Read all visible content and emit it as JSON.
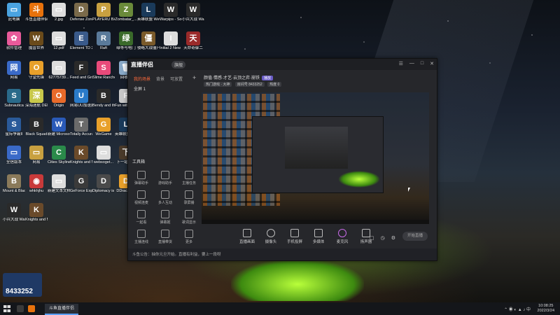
{
  "desktop_icons": [
    {
      "label": "此电脑",
      "color": "#4aa3e0",
      "glyph": "▭"
    },
    {
      "label": "斗鱼直播伴侣",
      "color": "#e8720c",
      "glyph": "斗"
    },
    {
      "label": "2.jpg",
      "color": "#dddddd",
      "glyph": "▭"
    },
    {
      "label": "Defense Zone 3 Ult...",
      "color": "#7a6a4a",
      "glyph": "D"
    },
    {
      "label": "PLAYERU BATTLEGR...",
      "color": "#c8a040",
      "glyph": "P"
    },
    {
      "label": "Zombatar_...",
      "color": "#6a8a3a",
      "glyph": "Z"
    },
    {
      "label": "英雄联盟 WeGame版",
      "color": "#1a3a5a",
      "glyph": "L"
    },
    {
      "label": "Warpips - Soundtrack",
      "color": "#2a2a2a",
      "glyph": "W"
    },
    {
      "label": "小兵大战 Warpips...",
      "color": "#2a2a2a",
      "glyph": "W"
    },
    {
      "label": "软件管理",
      "color": "#e85a9a",
      "glyph": "✿"
    },
    {
      "label": "魔兽世界",
      "color": "#6a4a1a",
      "glyph": "W"
    },
    {
      "label": "12.pdf",
      "color": "#dddddd",
      "glyph": "▭"
    },
    {
      "label": "Element TD 2",
      "color": "#3a5a8a",
      "glyph": "E"
    },
    {
      "label": "Raft",
      "color": "#5a7a9a",
      "glyph": "R"
    },
    {
      "label": "绿等与电门",
      "color": "#3a6a2a",
      "glyph": "绿"
    },
    {
      "label": "侵略大战僵尸 2010周年纪...",
      "color": "#7a5a2a",
      "glyph": "僵"
    },
    {
      "label": "Initial 2 New Stories",
      "color": "#dddddd",
      "glyph": "I"
    },
    {
      "label": "天命奇御二",
      "color": "#9a2a2a",
      "glyph": "天"
    },
    {
      "label": "网易",
      "color": "#3a6ac8",
      "glyph": "网"
    },
    {
      "label": "守望先锋",
      "color": "#e8a02a",
      "glyph": "O"
    },
    {
      "label": "62775739...",
      "color": "#dddddd",
      "glyph": "▭"
    },
    {
      "label": "Feed and Grow Fish",
      "color": "#2a2a2a",
      "glyph": "F"
    },
    {
      "label": "Slime Rancher",
      "color": "#e84a7a",
      "glyph": "S"
    },
    {
      "label": "回收站",
      "color": "#8aaac8",
      "glyph": "🗑"
    },
    {
      "label": "腾讯QQ",
      "color": "#1a1a1a",
      "glyph": "Q"
    },
    {
      "label": "新建 Microsoft ...",
      "color": "#dddddd",
      "glyph": "▭"
    },
    {
      "label": "Fonts",
      "color": "#c83a2a",
      "glyph": "A"
    },
    {
      "label": "Subnautica",
      "color": "#2a6a8a",
      "glyph": "S"
    },
    {
      "label": "深海迷航 DEEEER...",
      "color": "#c8c84a",
      "glyph": "深"
    },
    {
      "label": "Origin",
      "color": "#e86a2a",
      "glyph": "O"
    },
    {
      "label": "网易UU加速器",
      "color": "#2a7ac8",
      "glyph": "U"
    },
    {
      "label": "Bendy and the Ink ...",
      "color": "#2a2a2a",
      "glyph": "B"
    },
    {
      "label": "Fun with Ragdoll...",
      "color": "#c8c8c8",
      "glyph": "F"
    },
    {
      "label": "They Are Billions",
      "color": "#6a5a3a",
      "glyph": "T"
    },
    {
      "label": "鬼谷八荒",
      "color": "#4a3a2a",
      "glyph": "鬼"
    },
    {
      "label": "Steam",
      "color": "#1a3a5a",
      "glyph": "S"
    },
    {
      "label": "星际争霸II",
      "color": "#2a5a9a",
      "glyph": "S"
    },
    {
      "label": "Black Squad",
      "color": "#2a2a2a",
      "glyph": "B"
    },
    {
      "label": "新建 Microsoft ...",
      "color": "#2a5ab8",
      "glyph": "W"
    },
    {
      "label": "Totally Accurat...",
      "color": "#6a6a6a",
      "glyph": "T"
    },
    {
      "label": "WeGame",
      "color": "#e8a02a",
      "glyph": "G"
    },
    {
      "label": "英雄联盟 WeGame版",
      "color": "#1a3a5a",
      "glyph": "L"
    },
    {
      "label": "Boris and the Dar...",
      "color": "#7a5a3a",
      "glyph": "B"
    },
    {
      "label": "Grounded",
      "color": "#3a8a2a",
      "glyph": "G"
    },
    {
      "label": "Totally Accurat...",
      "color": "#8a2a2a",
      "glyph": "T"
    },
    {
      "label": "全信版本",
      "color": "#3a6ac8",
      "glyph": "▭"
    },
    {
      "label": "网易",
      "color": "#c8a040",
      "glyph": "▭"
    },
    {
      "label": "Cities Skylines",
      "color": "#2a8a4a",
      "glyph": "C"
    },
    {
      "label": "Knights and Merchants",
      "color": "#6a4a2a",
      "glyph": "K"
    },
    {
      "label": "websoget...",
      "color": "#dddddd",
      "glyph": "▭"
    },
    {
      "label": "下一站江湖",
      "color": "#4a3a2a",
      "glyph": "下"
    },
    {
      "label": "全信行情",
      "color": "#3a6ac8",
      "glyph": "▭"
    },
    {
      "label": "1",
      "color": "#dddddd",
      "glyph": "▭"
    },
    {
      "label": "Clone Drone in t...",
      "color": "#3a3a3a",
      "glyph": "C"
    },
    {
      "label": "Mount & Blade II ...",
      "color": "#8a7a5a",
      "glyph": "B"
    },
    {
      "label": "whkhjhu",
      "color": "#c83a3a",
      "glyph": "◉"
    },
    {
      "label": "新建文本文档.txt",
      "color": "#dddddd",
      "glyph": "▭"
    },
    {
      "label": "GeForce Experience",
      "color": "#3a3a3a",
      "glyph": "G"
    },
    {
      "label": "Diplomacy is Not a...",
      "color": "#4a4a4a",
      "glyph": "D"
    },
    {
      "label": "DDraceN...",
      "color": "#e8a02a",
      "glyph": "D"
    },
    {
      "label": "Overcook...2",
      "color": "#c8c8c8",
      "glyph": "O"
    },
    {
      "label": "YY语音",
      "color": "#e8c82a",
      "glyph": "YY"
    },
    {
      "label": "英雄联盟",
      "color": "#1a3a5a",
      "glyph": "L"
    },
    {
      "label": "小兵大战 Warpips",
      "color": "#2a2a2a",
      "glyph": "W"
    },
    {
      "label": "Knights and Merchants...",
      "color": "#6a4a2a",
      "glyph": "K"
    }
  ],
  "viewer_counter": "8433252",
  "app": {
    "title": "直播伴侣",
    "version": "旗舰",
    "window_buttons": [
      "☰",
      "—",
      "□",
      "✕"
    ],
    "tabs": [
      "我的场景",
      "背景",
      "可放置"
    ],
    "scene": "全屏 1",
    "tools_title": "工具箱",
    "tools": [
      "弹幕助手",
      "游戏助手",
      "主播任务",
      "视频连麦",
      "多人互动",
      "录屏播",
      "一起看",
      "弹幕姬",
      "歌词显示",
      "主播连线",
      "直播带货",
      "更多"
    ],
    "header_title": "颜值·情感·才艺·云顶之弈·崩铁",
    "header_badge": "播放",
    "header_sub_tags": [
      "热门游戏 · 大神",
      "房间号 8433252",
      "热度 0"
    ],
    "controls": [
      "直播画面",
      "摄像头",
      "手机投屏",
      "多媒体",
      "麦克风",
      "扬声器"
    ],
    "go_live": "开始直播",
    "bottom_notice": "斗鱼公告：抽你元旦开始。直播有利益，要上一段呀"
  },
  "taskbar": {
    "app_label": "斗鱼直播伴侣",
    "time": "10:08:25",
    "date": "2022/3/24"
  }
}
